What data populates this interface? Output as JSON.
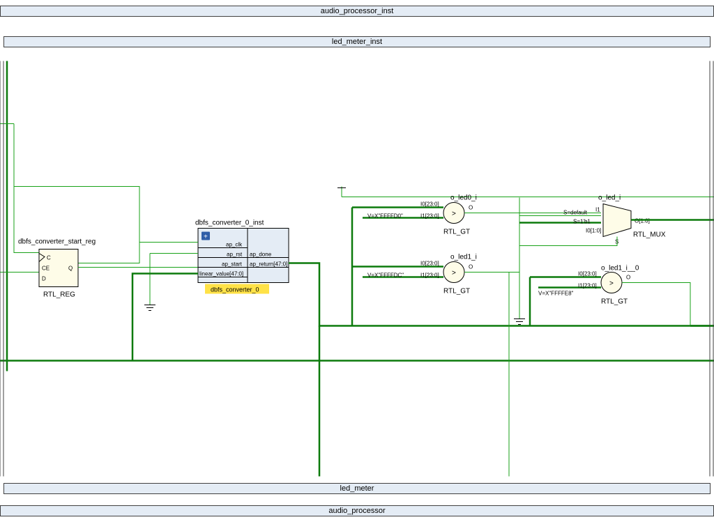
{
  "hierarchy": {
    "top_inst": "audio_processor_inst",
    "mid_inst": "led_meter_inst",
    "mid_type": "led_meter",
    "top_type": "audio_processor"
  },
  "blocks": {
    "reg": {
      "inst": "dbfs_converter_start_reg",
      "type": "RTL_REG",
      "pins": {
        "c": "C",
        "ce": "CE",
        "d": "D",
        "q": "Q"
      }
    },
    "conv": {
      "inst": "dbfs_converter_0_inst",
      "type": "dbfs_converter_0",
      "pins": {
        "ap_clk": "ap_clk",
        "ap_rst": "ap_rst",
        "ap_start": "ap_start",
        "linear_value": "linear_value[47:0]",
        "ap_done": "ap_done",
        "ap_return": "ap_return[47:0]"
      },
      "expand_icon": "+"
    },
    "gt0": {
      "inst": "o_led0_i",
      "type": "RTL_GT",
      "i0": "I0[23:0]",
      "i1": "I1[23:0]",
      "o": "O",
      "const": "V=X\"FFFFD0\""
    },
    "gt1": {
      "inst": "o_led1_i",
      "type": "RTL_GT",
      "i0": "I0[23:0]",
      "i1": "I1[23:0]",
      "o": "O",
      "const": "V=X\"FFFFDC\""
    },
    "gt2": {
      "inst": "o_led1_i__0",
      "type": "RTL_GT",
      "i0": "I0[23:0]",
      "i1": "I1[23:0]",
      "o": "O",
      "const": "V=X\"FFFFE8\""
    },
    "mux": {
      "inst": "o_led_i",
      "type": "RTL_MUX",
      "s_default": "S=default",
      "s1": "S=1'b1",
      "i1": "I1",
      "i0": "I0[1:0]",
      "o": "O[1:0]",
      "s": "S"
    }
  }
}
